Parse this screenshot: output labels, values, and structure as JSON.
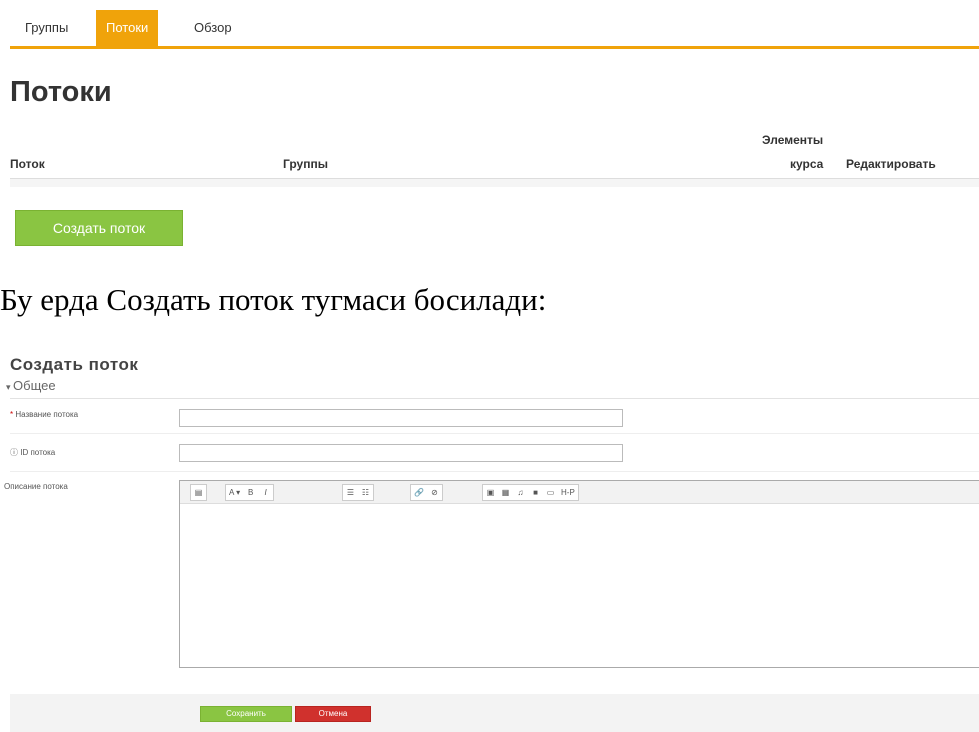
{
  "tabs": [
    {
      "label": "Группы"
    },
    {
      "label": "Потоки",
      "active": true
    },
    {
      "label": "Обзор"
    }
  ],
  "page_title": "Потоки",
  "table": {
    "headers": {
      "stream": "Поток",
      "groups": "Группы",
      "course_items_line1": "Элементы",
      "course_items_line2": "курса",
      "edit": "Редактировать"
    }
  },
  "create_button": "Создать поток",
  "caption": "Бу ерда Создать поток тугмаси босилади:",
  "form": {
    "title": "Создать поток",
    "section": "Общее",
    "name_label": "Название потока",
    "id_label": "ID потока",
    "description_label": "Описание потока",
    "name_value": "",
    "id_value": ""
  },
  "editor_toolbar": [
    [
      "▤"
    ],
    [
      "A ▾",
      "B",
      "I"
    ],
    [
      "☰",
      "☷"
    ],
    [
      "🔗",
      "⊘"
    ],
    [
      "▣",
      "▦",
      "♫",
      "■",
      "▭",
      "H-P"
    ]
  ],
  "footer": {
    "save_label": "Сохранить",
    "cancel_label": "Отмена"
  },
  "colors": {
    "accent": "#f0a30a",
    "green": "#8ac542",
    "red": "#d0312d"
  }
}
